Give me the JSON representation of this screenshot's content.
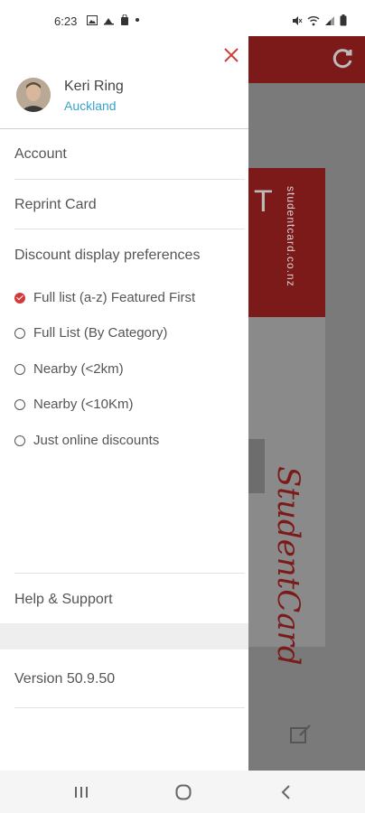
{
  "status_bar": {
    "time": "6:23",
    "left_icons": [
      "image-icon",
      "cloud-icon",
      "shopping-bag-icon",
      "dot-icon"
    ],
    "right_icons": [
      "mute-icon",
      "wifi-icon",
      "signal-icon",
      "battery-icon"
    ]
  },
  "drawer": {
    "user": {
      "name": "Keri Ring",
      "location": "Auckland"
    },
    "menu": {
      "account": "Account",
      "reprint": "Reprint Card",
      "preferences_label": "Discount display preferences"
    },
    "preferences": [
      {
        "label": "Full list (a-z) Featured First",
        "selected": true
      },
      {
        "label": "Full List (By Category)",
        "selected": false
      },
      {
        "label": "Nearby (<2km)",
        "selected": false
      },
      {
        "label": "Nearby (<10Km)",
        "selected": false
      },
      {
        "label": "Just online discounts",
        "selected": false
      }
    ],
    "help": "Help & Support",
    "version": "Version 50.9.50"
  },
  "background": {
    "site_text": "studentcard.co.nz",
    "brand_text": "StudentCard",
    "card_letter": "T"
  },
  "colors": {
    "accent": "#d23a3a",
    "link": "#3aa3c8",
    "header_dim": "#7c1a1a"
  }
}
